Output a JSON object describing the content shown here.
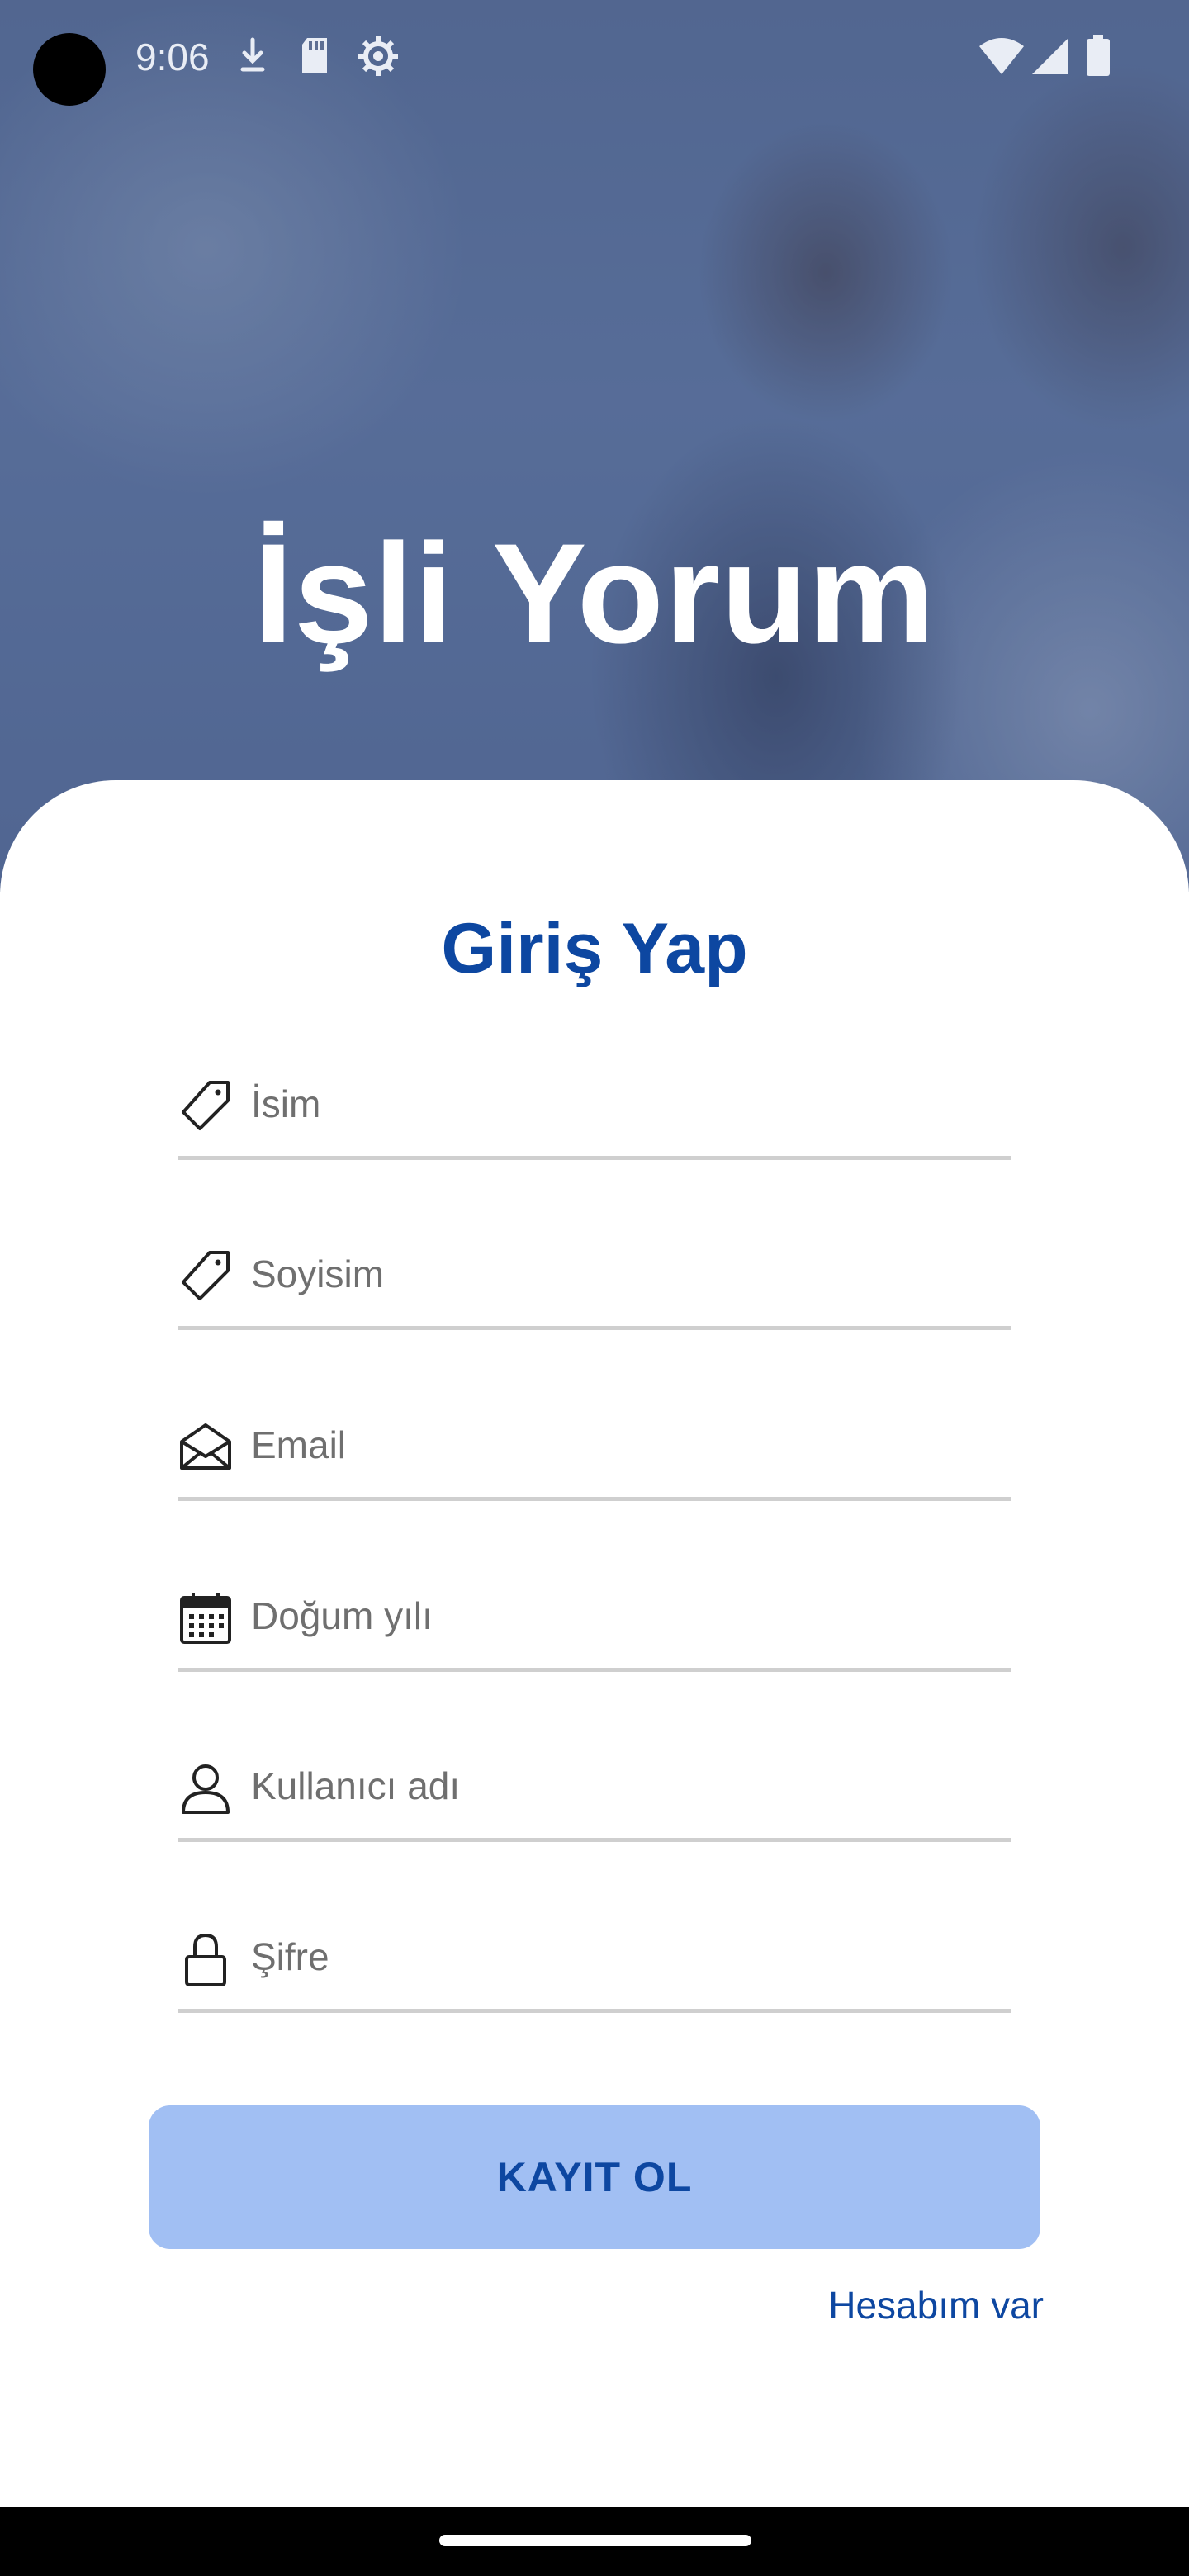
{
  "status_bar": {
    "time": "9:06",
    "icons": [
      "download-icon",
      "sd-card-icon",
      "settings-icon",
      "wifi-icon",
      "signal-icon",
      "battery-icon"
    ]
  },
  "hero": {
    "title": "İşli Yorum"
  },
  "form": {
    "title": "Giriş Yap",
    "fields": [
      {
        "icon": "tag-icon",
        "placeholder": "İsim",
        "value": ""
      },
      {
        "icon": "tag-icon",
        "placeholder": "Soyisim",
        "value": ""
      },
      {
        "icon": "mail-icon",
        "placeholder": "Email",
        "value": ""
      },
      {
        "icon": "calendar-icon",
        "placeholder": "Doğum yılı",
        "value": ""
      },
      {
        "icon": "person-icon",
        "placeholder": "Kullanıcı adı",
        "value": ""
      },
      {
        "icon": "lock-icon",
        "placeholder": "Şifre",
        "value": ""
      }
    ],
    "register_label": "KAYIT OL",
    "login_link": "Hesabım var"
  },
  "colors": {
    "primary": "#0d47a1",
    "button_bg": "#a1bff3",
    "field_line": "#cfcfcf"
  }
}
